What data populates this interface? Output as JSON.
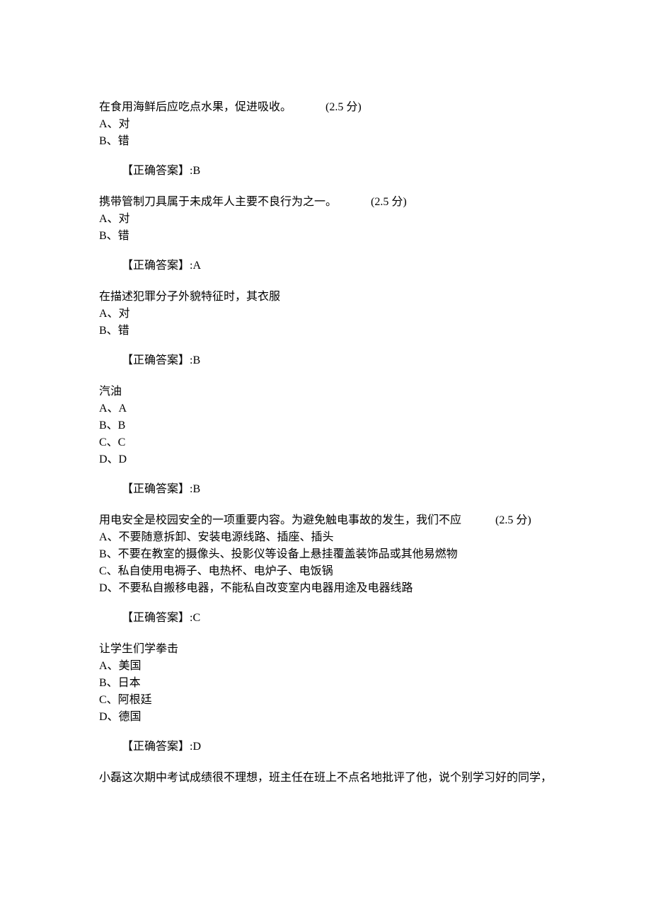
{
  "questions": [
    {
      "text": "在食用海鲜后应吃点水果，促进吸收。",
      "points": "(2.5 分)",
      "options": [
        "A、对",
        "B、错"
      ],
      "answer": "【正确答案】:B"
    },
    {
      "text": "携带管制刀具属于未成年人主要不良行为之一。",
      "points": "(2.5 分)",
      "options": [
        "A、对",
        "B、错"
      ],
      "answer": "【正确答案】:A"
    },
    {
      "text": "在描述犯罪分子外貌特征时，其衣服",
      "points": "",
      "options": [
        "A、对",
        "B、错"
      ],
      "answer": "【正确答案】:B"
    },
    {
      "text": "汽油",
      "points": "",
      "options": [
        "A、A",
        "B、B",
        "C、C",
        "D、D"
      ],
      "answer": "【正确答案】:B"
    },
    {
      "text": "用电安全是校园安全的一项重要内容。为避免触电事故的发生，我们不应",
      "points": "(2.5 分)",
      "options": [
        "A、不要随意拆卸、安装电源线路、插座、插头",
        "B、不要在教室的摄像头、投影仪等设备上悬挂覆盖装饰品或其他易燃物",
        "C、私自使用电褥子、电热杯、电炉子、电饭锅",
        "D、不要私自搬移电器，不能私自改变室内电器用途及电器线路"
      ],
      "answer": "【正确答案】:C"
    },
    {
      "text": "让学生们学拳击",
      "points": "",
      "options": [
        "A、美国",
        "B、日本",
        "C、阿根廷",
        "D、德国"
      ],
      "answer": "【正确答案】:D"
    }
  ],
  "continuation": "小磊这次期中考试成绩很不理想，班主任在班上不点名地批评了他，说个别学习好的同学，"
}
